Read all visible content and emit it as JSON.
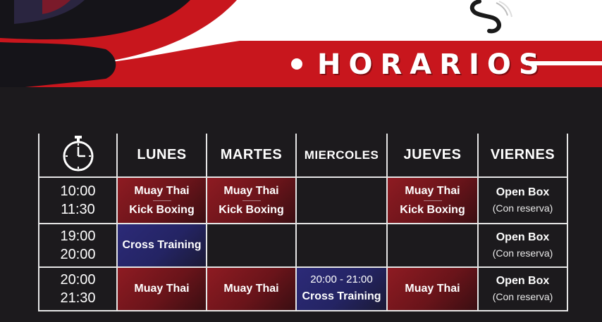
{
  "header": {
    "title": "HORARIOS"
  },
  "days": [
    "LUNES",
    "MARTES",
    "MIERCOLES",
    "JUEVES",
    "VIERNES"
  ],
  "slots": [
    {
      "start": "10:00",
      "end": "11:30"
    },
    {
      "start": "19:00",
      "end": "20:00"
    },
    {
      "start": "20:00",
      "end": "21:30"
    }
  ],
  "classes": {
    "muay_thai": "Muay Thai",
    "kick_boxing": "Kick Boxing",
    "cross_training": "Cross Training",
    "open_box": "Open Box",
    "con_reserva": "(Con reserva)",
    "wed_time": "20:00 - 21:00"
  },
  "colors": {
    "accent_red": "#c8161d",
    "background": "#1c1a1d",
    "blue": "#2c2a78"
  },
  "icons": {
    "clock": "stopwatch-icon"
  }
}
